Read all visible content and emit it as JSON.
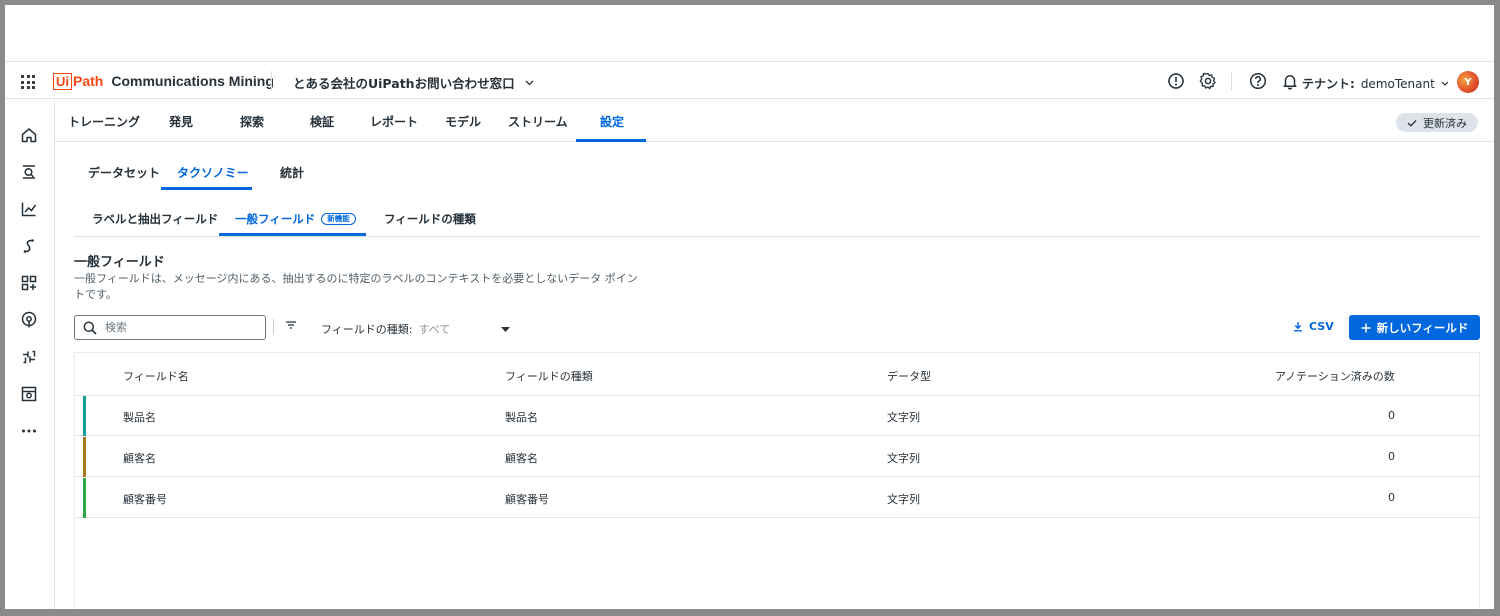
{
  "app": {
    "logo_ui": "Ui",
    "logo_path": "Path",
    "product": "Communications Mining",
    "project": "とある会社のUiPathお問い合わせ窓口",
    "tenant_label": "テナント:",
    "tenant_value": "demoTenant",
    "avatar_initial": "Y"
  },
  "main_tabs": [
    {
      "label": "トレーニング"
    },
    {
      "label": "発見"
    },
    {
      "label": "探索"
    },
    {
      "label": "検証"
    },
    {
      "label": "レポート"
    },
    {
      "label": "モデル"
    },
    {
      "label": "ストリーム"
    },
    {
      "label": "設定"
    }
  ],
  "status_badge": "更新済み",
  "sub_tabs": [
    {
      "label": "データセット"
    },
    {
      "label": "タクソノミー"
    },
    {
      "label": "統計"
    }
  ],
  "taxonomy_tabs": [
    {
      "label": "ラベルと抽出フィールド"
    },
    {
      "label": "一般フィールド",
      "badge": "新機能"
    },
    {
      "label": "フィールドの種類"
    }
  ],
  "section": {
    "title": "一般フィールド",
    "description": "一般フィールドは、メッセージ内にある、抽出するのに特定のラベルのコンテキストを必要としないデータ ポイントです。"
  },
  "search": {
    "placeholder": "検索"
  },
  "filter": {
    "label": "フィールドの種類:",
    "value": "すべて"
  },
  "actions": {
    "csv": "CSV",
    "new_field": "新しいフィールド"
  },
  "table": {
    "headers": [
      "フィールド名",
      "フィールドの種類",
      "データ型",
      "アノテーション済みの数"
    ],
    "rows": [
      {
        "name": "製品名",
        "type": "製品名",
        "data_type": "文字列",
        "count": "0",
        "color": "#1a9e9a"
      },
      {
        "name": "顧客名",
        "type": "顧客名",
        "data_type": "文字列",
        "count": "0",
        "color": "#a87a1e"
      },
      {
        "name": "顧客番号",
        "type": "顧客番号",
        "data_type": "文字列",
        "count": "0",
        "color": "#2aa84a"
      }
    ]
  },
  "colors": {
    "accent": "#0067df",
    "brand": "#fa4616"
  }
}
